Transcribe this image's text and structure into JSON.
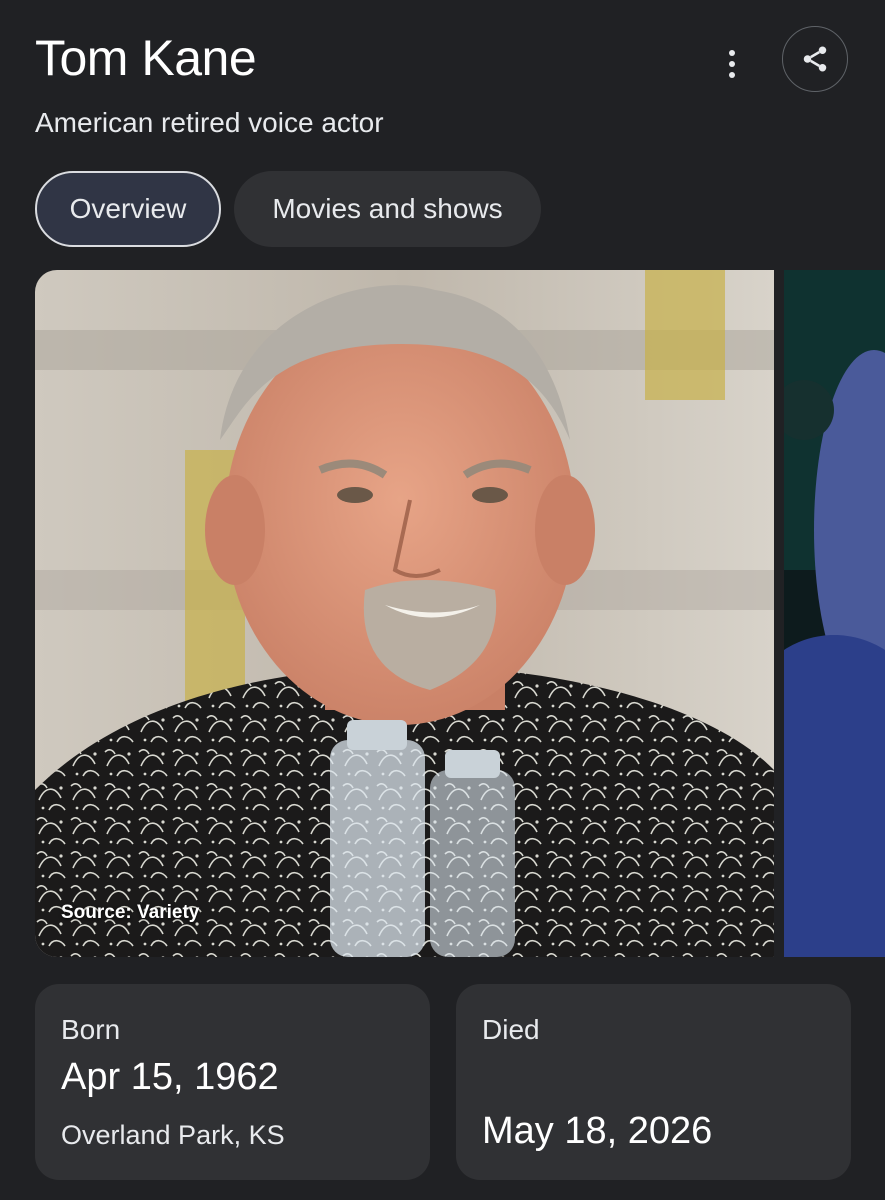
{
  "header": {
    "name": "Tom Kane",
    "description": "American retired voice actor",
    "more_icon": "more-vert-icon",
    "share_icon": "share-icon"
  },
  "tabs": [
    {
      "label": "Overview",
      "active": true
    },
    {
      "label": "Movies and shows",
      "active": false
    }
  ],
  "image": {
    "source_caption": "Source: Variety"
  },
  "facts": {
    "born": {
      "label": "Born",
      "date": "Apr 15, 1962",
      "place": "Overland Park, KS"
    },
    "died": {
      "label": "Died",
      "date": "May 18, 2026"
    }
  },
  "colors": {
    "background": "#202124",
    "card": "#303134",
    "active_tab": "#303545"
  }
}
